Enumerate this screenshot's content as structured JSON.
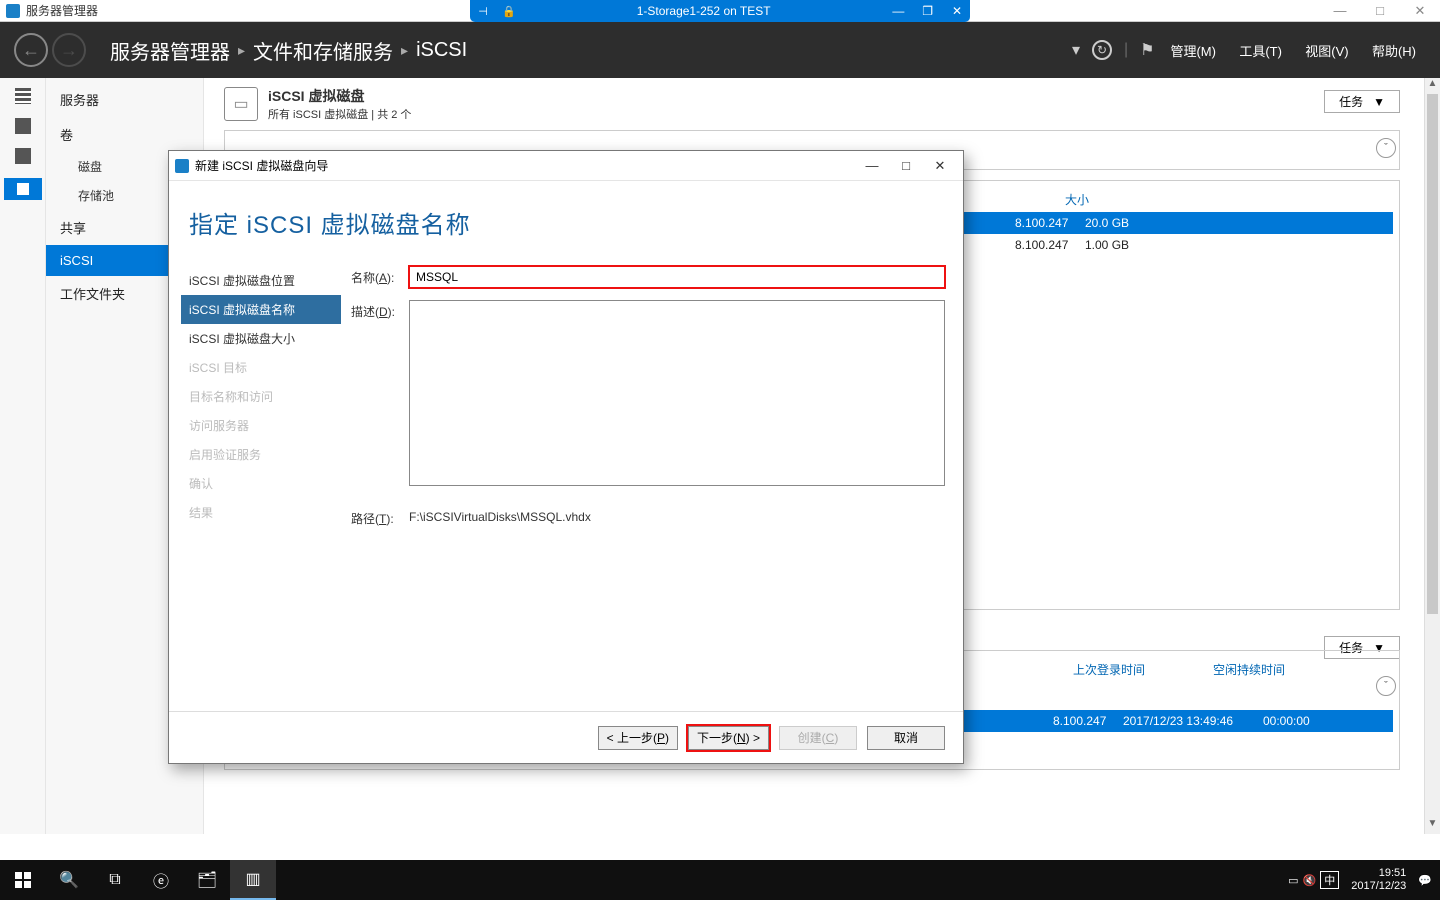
{
  "host_window": {
    "min": "—",
    "max": "□",
    "close": "✕"
  },
  "rdp": {
    "title": "1-Storage1-252 on TEST"
  },
  "sm_title": "服务器管理器",
  "breadcrumb": {
    "a": "服务器管理器",
    "b": "文件和存储服务",
    "c": "iSCSI"
  },
  "header_menus": {
    "manage": "管理(M)",
    "tools": "工具(T)",
    "view": "视图(V)",
    "help": "帮助(H)"
  },
  "nav": {
    "servers": "服务器",
    "volumes": "卷",
    "disks": "磁盘",
    "pools": "存储池",
    "shares": "共享",
    "iscsi": "iSCSI",
    "workfolders": "工作文件夹"
  },
  "section": {
    "title": "iSCSI 虚拟磁盘",
    "sub": "所有 iSCSI 虚拟磁盘 | 共 2 个",
    "tasks": "任务"
  },
  "grid": {
    "h_size": "大小",
    "rows": [
      {
        "ip": "8.100.247",
        "size": "20.0 GB"
      },
      {
        "ip": "8.100.247",
        "size": "1.00 GB"
      }
    ]
  },
  "sessions": {
    "h_login": "上次登录时间",
    "h_idle": "空闲持续时间",
    "row": {
      "ip": "8.100.247",
      "login": "2017/12/23 13:49:46",
      "idle": "00:00:00"
    }
  },
  "wizard": {
    "title": "新建 iSCSI 虚拟磁盘向导",
    "heading": "指定 iSCSI 虚拟磁盘名称",
    "steps": {
      "loc": "iSCSI 虚拟磁盘位置",
      "name": "iSCSI 虚拟磁盘名称",
      "size": "iSCSI 虚拟磁盘大小",
      "target": "iSCSI 目标",
      "tnaccess": "目标名称和访问",
      "access": "访问服务器",
      "auth": "启用验证服务",
      "confirm": "确认",
      "result": "结果"
    },
    "labels": {
      "name": "名称(A):",
      "desc": "描述(D):",
      "path": "路径(T):"
    },
    "values": {
      "name": "MSSQL",
      "desc": "",
      "path": "F:\\iSCSIVirtualDisks\\MSSQL.vhdx"
    },
    "buttons": {
      "prev": "< 上一步(P)",
      "next": "下一步(N) >",
      "create": "创建(C)",
      "cancel": "取消"
    }
  },
  "taskbar": {
    "time": "19:51",
    "date": "2017/12/23",
    "ime": "中"
  }
}
